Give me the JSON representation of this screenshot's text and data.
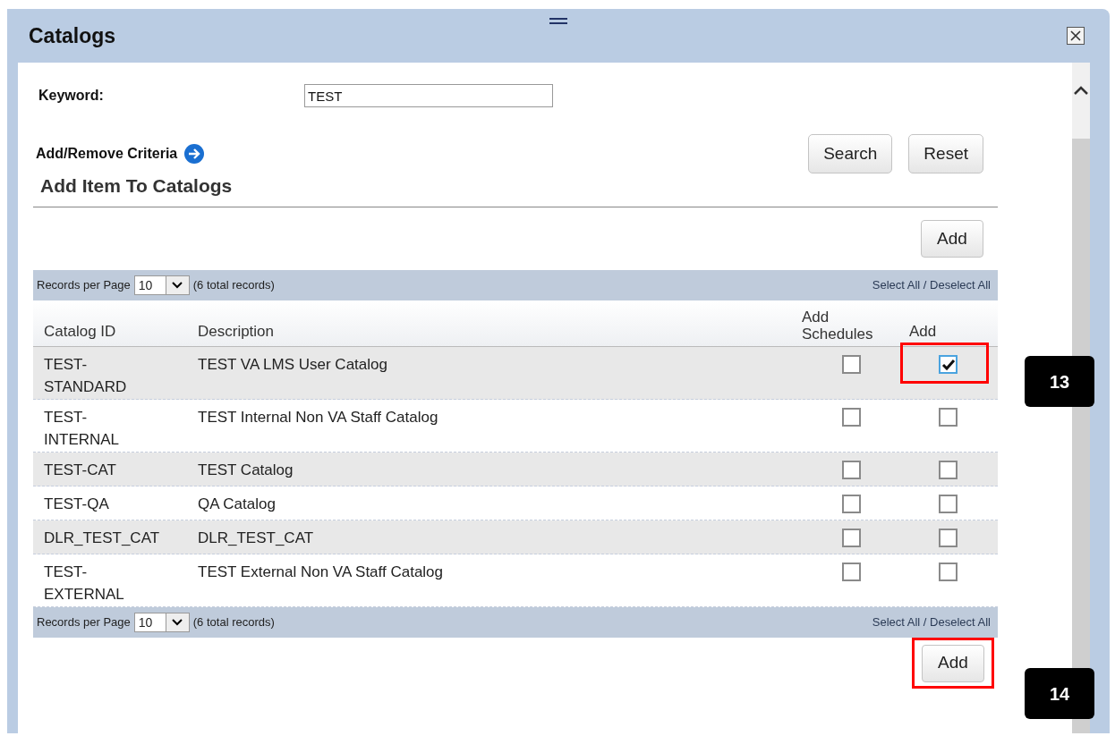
{
  "window": {
    "title": "Catalogs"
  },
  "search": {
    "keyword_label": "Keyword:",
    "keyword_value": "TEST",
    "criteria_link": "Add/Remove Criteria",
    "buttons": [
      "Search",
      "Reset"
    ]
  },
  "section_title": "Add Item To Catalogs",
  "top_add_button": {
    "label": "Add",
    "highlighted": false
  },
  "toolbar_top": {
    "records_label": "Records per Page",
    "per_page": "10",
    "total": "(6 total records)",
    "select_all": "Select All / Deselect All"
  },
  "table": {
    "columns": [
      "Catalog ID",
      "Description",
      "Add Schedules",
      "Add"
    ],
    "rows": [
      {
        "id": "TEST-\nSTANDARD",
        "description": "TEST VA LMS User Catalog",
        "add_schedules": false,
        "add": true,
        "highlighted": true
      },
      {
        "id": "TEST-\nINTERNAL",
        "description": "TEST Internal Non VA Staff Catalog",
        "add_schedules": false,
        "add": false,
        "highlighted": false
      },
      {
        "id": "TEST-CAT",
        "description": "TEST Catalog",
        "add_schedules": false,
        "add": false,
        "highlighted": false
      },
      {
        "id": "TEST-QA",
        "description": "QA Catalog",
        "add_schedules": false,
        "add": false,
        "highlighted": false
      },
      {
        "id": "DLR_TEST_CAT",
        "description": "DLR_TEST_CAT",
        "add_schedules": false,
        "add": false,
        "highlighted": false
      },
      {
        "id": "TEST-\nEXTERNAL",
        "description": "TEST External Non VA Staff Catalog",
        "add_schedules": false,
        "add": false,
        "highlighted": false
      }
    ]
  },
  "toolbar_bottom": {
    "records_label": "Records per Page",
    "per_page": "10",
    "total": "(6 total records)",
    "select_all": "Select All / Deselect All"
  },
  "bottom_add_button": {
    "label": "Add",
    "highlighted": true
  },
  "callouts": [
    {
      "label": "13"
    },
    {
      "label": "14"
    }
  ]
}
